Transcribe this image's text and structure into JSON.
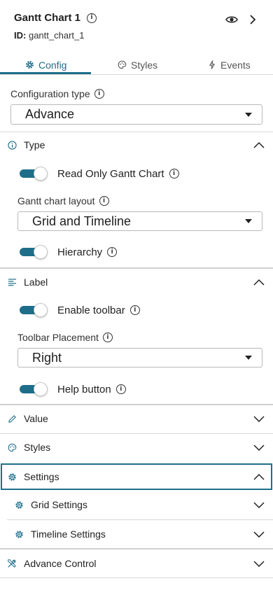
{
  "header": {
    "title": "Gantt Chart 1",
    "id_label": "ID:",
    "id_value": "gantt_chart_1"
  },
  "tabs": [
    {
      "label": "Config",
      "icon": "gear-icon",
      "active": true
    },
    {
      "label": "Styles",
      "icon": "palette-icon",
      "active": false
    },
    {
      "label": "Events",
      "icon": "bolt-icon",
      "active": false
    }
  ],
  "config": {
    "type_label": "Configuration type",
    "type_value": "Advance"
  },
  "sections": {
    "type": {
      "title": "Type",
      "read_only_label": "Read Only Gantt Chart",
      "read_only_on": true,
      "layout_label": "Gantt chart layout",
      "layout_value": "Grid and Timeline",
      "hierarchy_label": "Hierarchy",
      "hierarchy_on": true
    },
    "label": {
      "title": "Label",
      "toolbar_label": "Enable toolbar",
      "toolbar_on": true,
      "placement_label": "Toolbar Placement",
      "placement_value": "Right",
      "help_label": "Help button",
      "help_on": true
    },
    "value": {
      "title": "Value"
    },
    "styles": {
      "title": "Styles"
    },
    "settings": {
      "title": "Settings",
      "grid": "Grid Settings",
      "timeline": "Timeline Settings"
    },
    "advance": {
      "title": "Advance Control"
    }
  },
  "colors": {
    "accent": "#1e6e8a",
    "border": "#d8d8d8"
  }
}
